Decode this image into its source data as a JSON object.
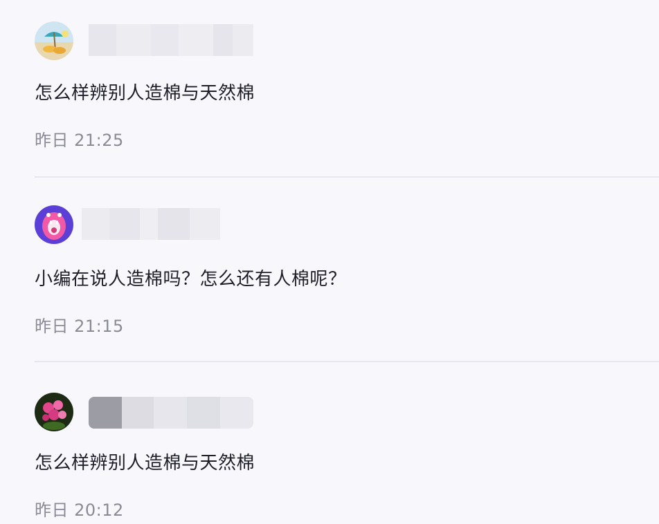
{
  "comments": [
    {
      "avatar": "beach-umbrella-avatar",
      "text": "怎么样辨别人造棉与天然棉",
      "time": "昨日 21:25"
    },
    {
      "avatar": "pink-monster-avatar",
      "text": "小编在说人造棉吗？怎么还有人棉呢？",
      "time": "昨日 21:15"
    },
    {
      "avatar": "pink-flower-avatar",
      "text": "怎么样辨别人造棉与天然棉",
      "time": "昨日 20:12"
    }
  ],
  "colors": {
    "background": "#f8f8fc",
    "text": "#1e1e28",
    "timestamp": "#8a8a95",
    "divider": "#e6e6ee"
  }
}
